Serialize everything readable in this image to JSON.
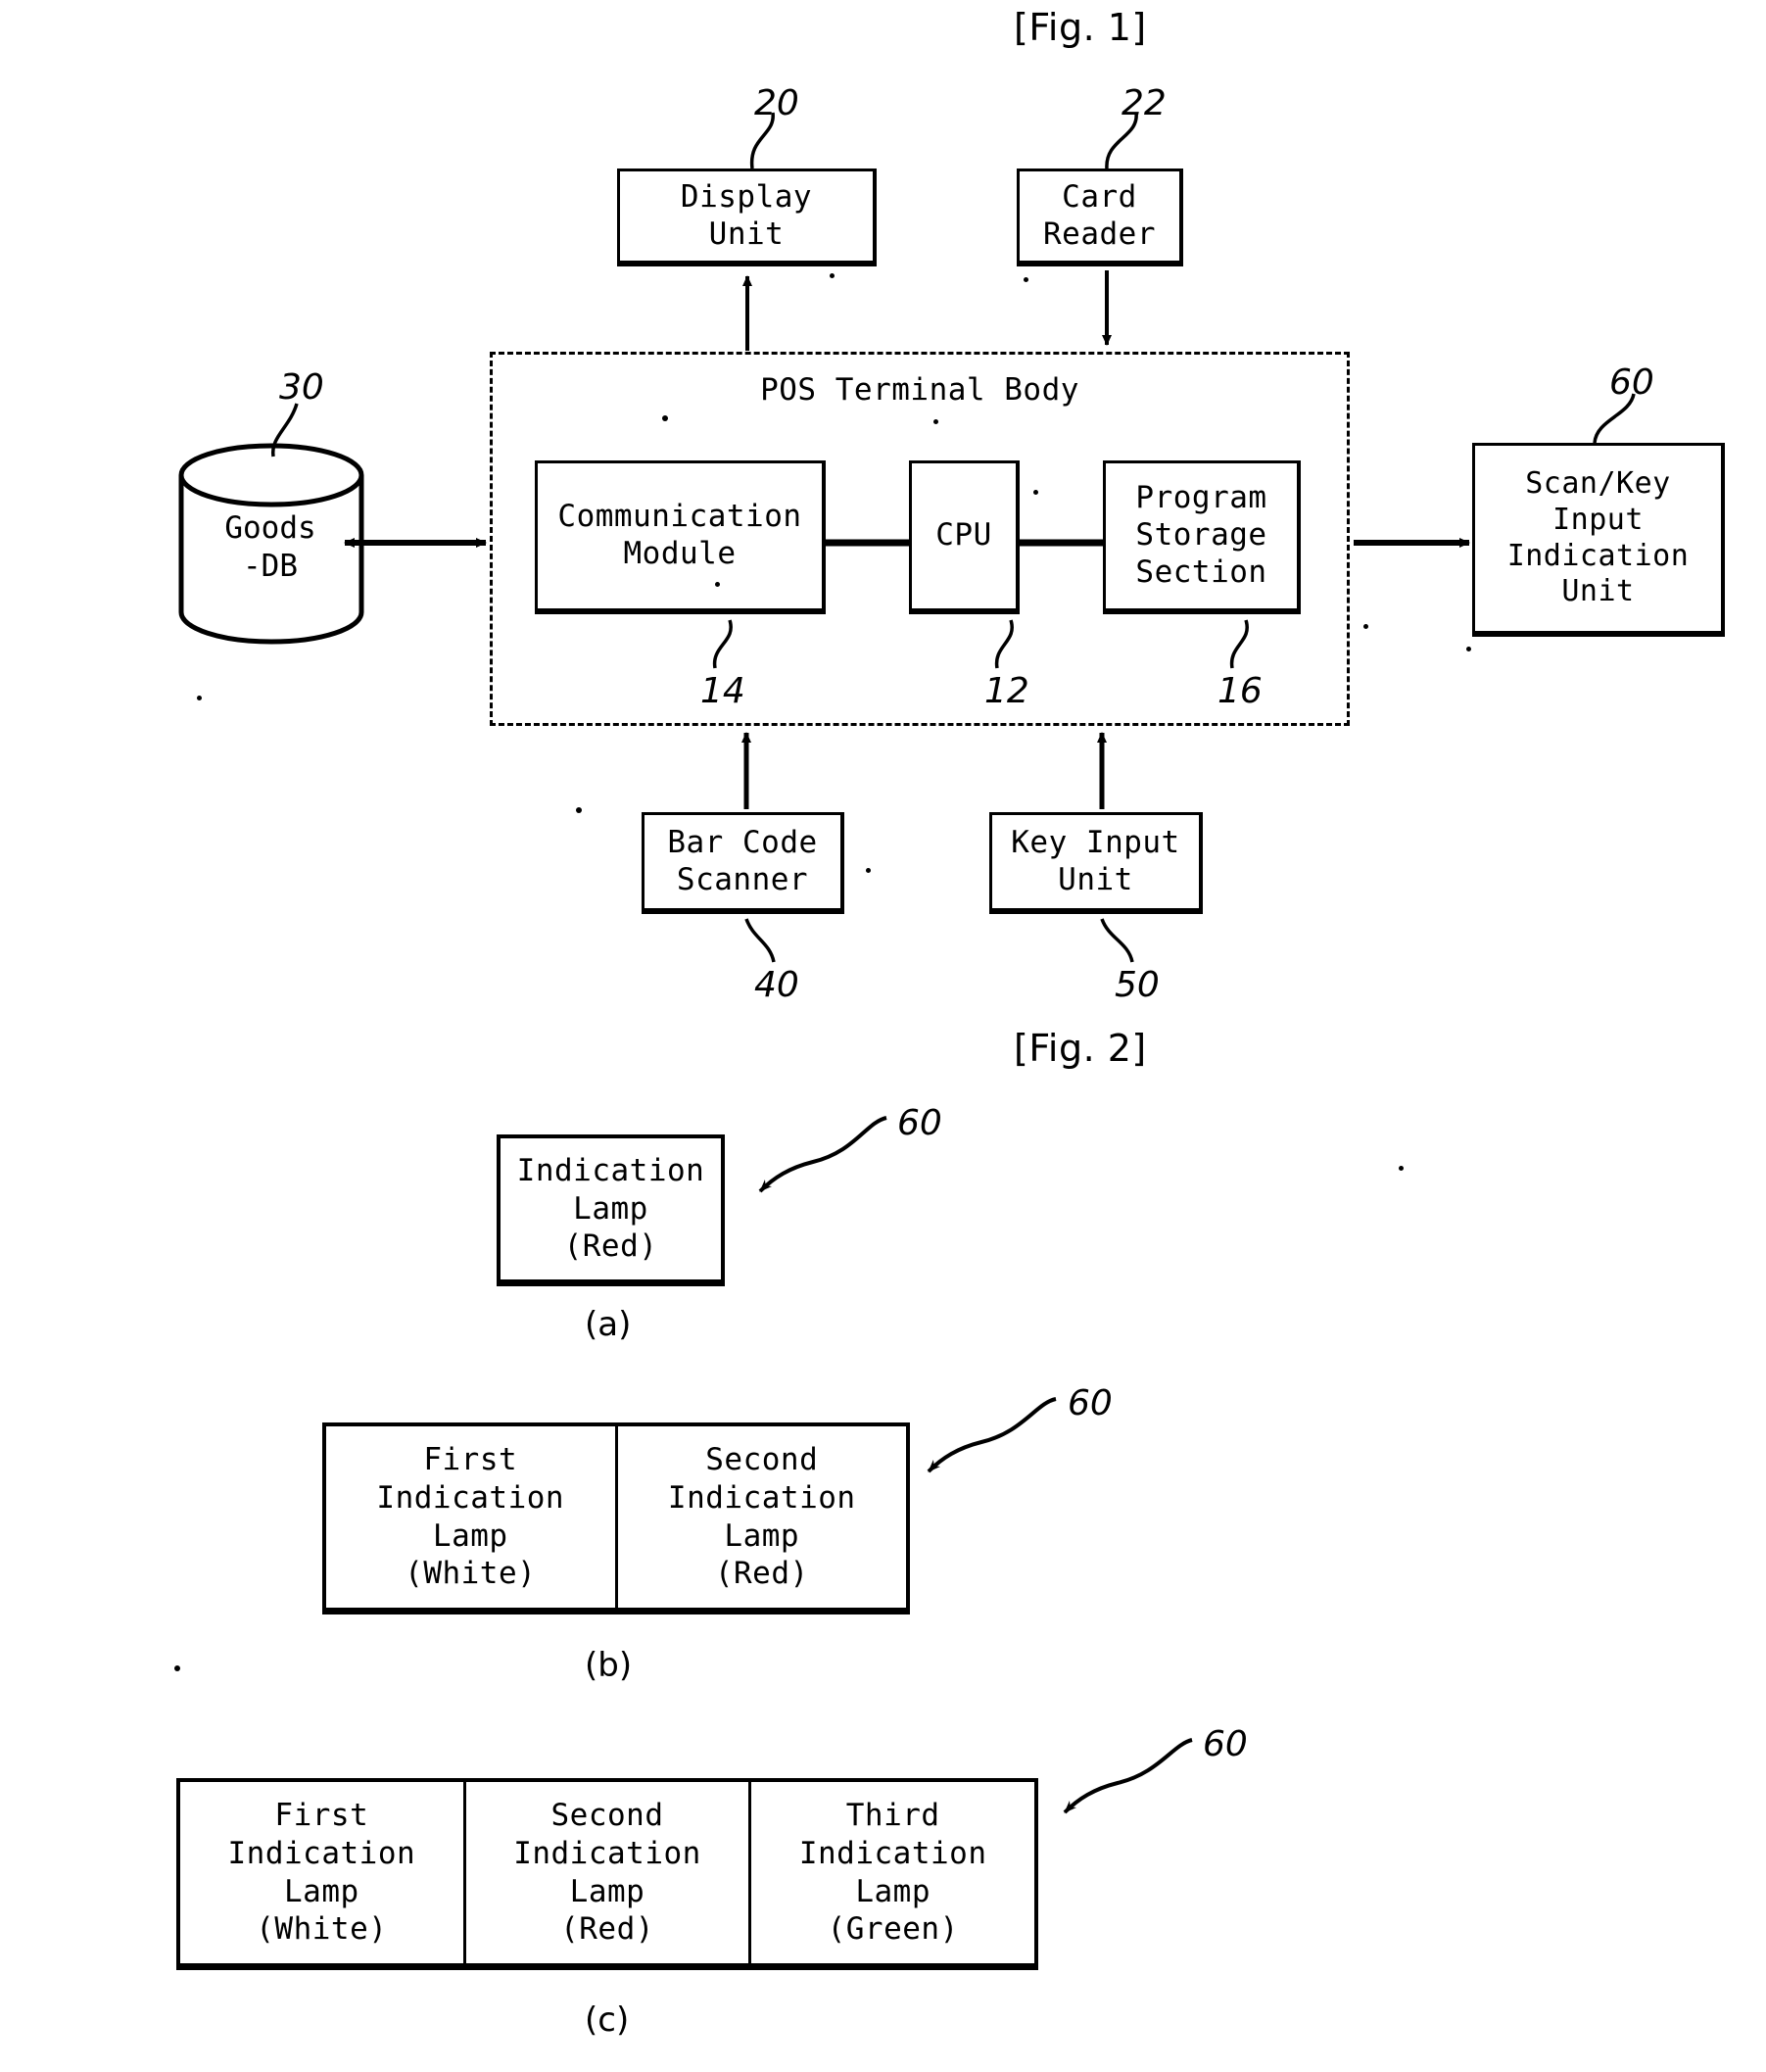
{
  "figures": [
    {
      "id": "fig1",
      "title": "[Fig. 1]"
    },
    {
      "id": "fig2",
      "title": "[Fig. 2]"
    }
  ],
  "fig1": {
    "title": "[Fig. 1]",
    "blocks": {
      "display_unit": {
        "label": "Display\nUnit",
        "ref": "20"
      },
      "card_reader": {
        "label": "Card\nReader",
        "ref": "22"
      },
      "goods_db": {
        "label": "Goods\n-DB",
        "ref": "30"
      },
      "pos_body": {
        "label": "POS Terminal Body"
      },
      "communication_module": {
        "label": "Communication\nModule",
        "ref": "14"
      },
      "cpu": {
        "label": "CPU",
        "ref": "12"
      },
      "program_storage": {
        "label": "Program\nStorage\nSection",
        "ref": "16"
      },
      "scan_key_indication": {
        "label": "Scan/Key\nInput\nIndication\nUnit",
        "ref": "60"
      },
      "bar_code_scanner": {
        "label": "Bar Code\nScanner",
        "ref": "40"
      },
      "key_input_unit": {
        "label": "Key Input\nUnit",
        "ref": "50"
      }
    }
  },
  "fig2": {
    "title": "[Fig. 2]",
    "panels": [
      {
        "caption": "(a)",
        "ref": "60",
        "cells": [
          {
            "name": "Indication\nLamp\n(Red)",
            "color_name": "Red"
          }
        ]
      },
      {
        "caption": "(b)",
        "ref": "60",
        "cells": [
          {
            "name": "First\nIndication\nLamp\n(White)",
            "color_name": "White"
          },
          {
            "name": "Second\nIndication\nLamp\n(Red)",
            "color_name": "Red"
          }
        ]
      },
      {
        "caption": "(c)",
        "ref": "60",
        "cells": [
          {
            "name": "First\nIndication\nLamp\n(White)",
            "color_name": "White"
          },
          {
            "name": "Second\nIndication\nLamp\n(Red)",
            "color_name": "Red"
          },
          {
            "name": "Third\nIndication\nLamp\n(Green)",
            "color_name": "Green"
          }
        ]
      }
    ]
  },
  "colors": {
    "ink": "#000000",
    "paper": "#ffffff"
  }
}
